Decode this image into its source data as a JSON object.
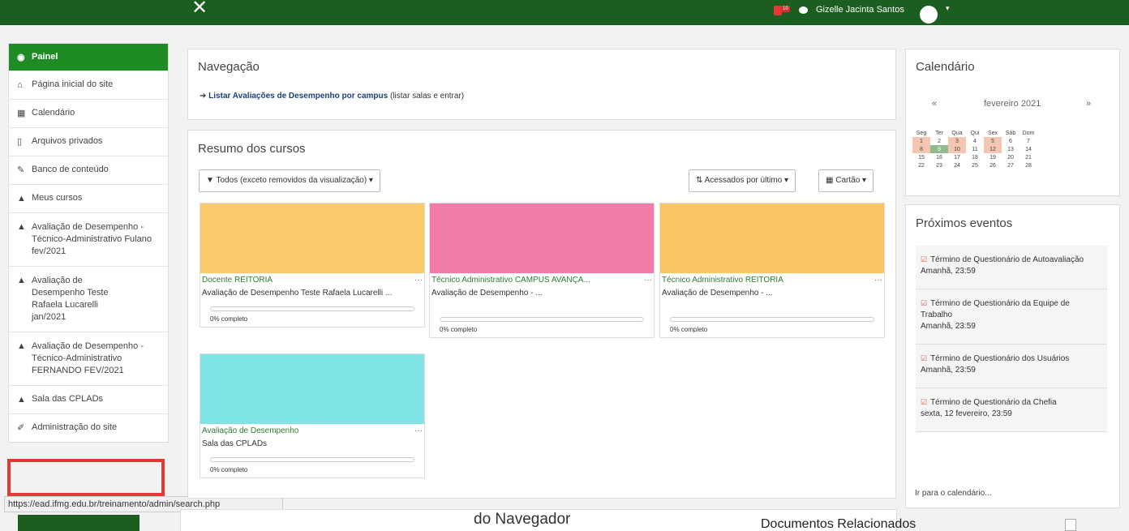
{
  "topbar": {
    "close_glyph": "✕",
    "notif_count": "10",
    "user_name": "Gizelle Jacinta Santos",
    "caret": "▾"
  },
  "leftnav": {
    "items": [
      {
        "label": "Painel",
        "icon": "dashboard-icon"
      },
      {
        "label": "Página inicial do site",
        "icon": "home-icon"
      },
      {
        "label": "Calendário",
        "icon": "calendar-icon"
      },
      {
        "label": "Arquivos privados",
        "icon": "file-icon"
      },
      {
        "label": "Banco de conteúdo",
        "icon": "brush-icon"
      },
      {
        "label": "Meus cursos",
        "icon": "graduation-cap-icon"
      },
      {
        "label": "Avaliação de Desempenho - Técnico-Administrativo Fulano fev/2021",
        "icon": "graduation-cap-icon"
      },
      {
        "label": "Avaliação de Desempenho Teste Rafaela Lucarelli jan/2021",
        "icon": "graduation-cap-icon"
      },
      {
        "label": "Avaliação de Desempenho - Técnico-Administrativo FERNANDO FEV/2021",
        "icon": "graduation-cap-icon"
      },
      {
        "label": "Sala das CPLADs",
        "icon": "graduation-cap-icon"
      },
      {
        "label": "Administração do site",
        "icon": "wrench-icon"
      }
    ]
  },
  "status_url": "https://ead.ifmg.edu.br/treinamento/admin/search.php",
  "navigation": {
    "title": "Navegação",
    "link_label": "Listar Avaliações de Desempenho por campus",
    "link_hint": "(listar salas e entrar)"
  },
  "summary": {
    "title": "Resumo dos cursos",
    "filter_label": "Todos (exceto removidos da visualização)",
    "sort_label": "Acessados por último",
    "view_label": "Cartão",
    "courses": [
      {
        "category": "Docente REITORIA",
        "name": "Avaliação de Desempenho Teste Rafaela Lucarelli ...",
        "progress": "0% completo",
        "color": "#f9c96c"
      },
      {
        "category": "Técnico Administrativo CAMPUS AVANÇA...",
        "name": "Avaliação de Desempenho - ...",
        "progress": "0% completo",
        "color": "#f07aa8"
      },
      {
        "category": "Técnico Administrativo REITORIA",
        "name": "Avaliação de Desempenho - ...",
        "progress": "0% completo",
        "color": "#f8c663"
      },
      {
        "category": "Avaliação de Desempenho",
        "name": "Sala das CPLADs",
        "progress": "0% completo",
        "color": "#7fe3e3"
      }
    ]
  },
  "background": {
    "partial_title": "do Navegador",
    "docs_title": "Documentos Relacionados"
  },
  "calendar": {
    "title": "Calendário",
    "prev": "«",
    "month": "fevereiro 2021",
    "next": "»",
    "weekdays": [
      "Seg",
      "Ter",
      "Qua",
      "Qui",
      "Sex",
      "Sáb",
      "Dom"
    ],
    "weeks": [
      [
        "1",
        "2",
        "3",
        "4",
        "5",
        "6",
        "7"
      ],
      [
        "8",
        "9",
        "10",
        "11",
        "12",
        "13",
        "14"
      ],
      [
        "15",
        "16",
        "17",
        "18",
        "19",
        "20",
        "21"
      ],
      [
        "22",
        "23",
        "24",
        "25",
        "26",
        "27",
        "28"
      ]
    ]
  },
  "events": {
    "title": "Próximos eventos",
    "items": [
      {
        "title": "Término de Questionário de Autoavaliação",
        "when": "Amanhã, 23:59"
      },
      {
        "title": "Término de Questionário da Equipe de Trabalho",
        "when": "Amanhã, 23:59"
      },
      {
        "title": "Término de Questionário dos Usuários",
        "when": "Amanhã, 23:59"
      },
      {
        "title": "Término de Questionário da Chefia",
        "when": "sexta, 12 fevereiro, 23:59"
      }
    ],
    "calendar_link": "Ir para o calendário..."
  },
  "colors": {
    "brand": "#1f8b24",
    "topbar": "#1b5e20",
    "highlight": "#e53935"
  }
}
